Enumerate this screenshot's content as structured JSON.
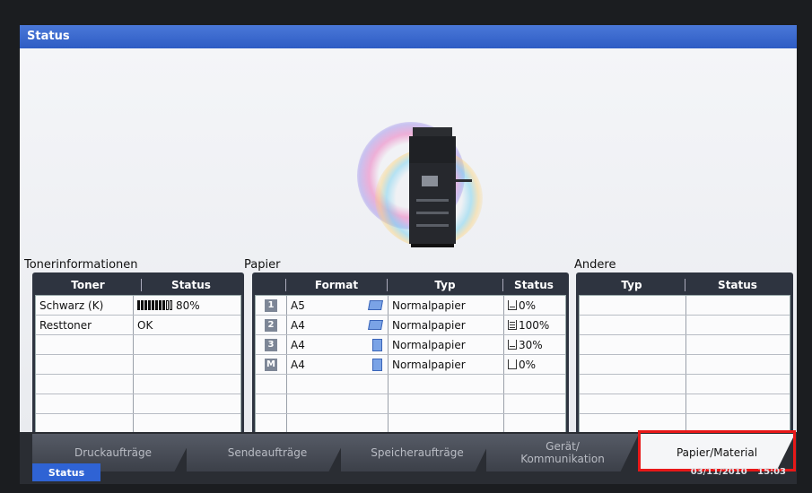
{
  "title": "Status",
  "sections": {
    "toner": "Tonerinformationen",
    "paper": "Papier",
    "other": "Andere"
  },
  "toner_table": {
    "headers": [
      "Toner",
      "Status"
    ],
    "rows": [
      {
        "name": "Schwarz (K)",
        "status": "80%",
        "level_fraction": 0.8
      },
      {
        "name": "Resttoner",
        "status": "OK"
      }
    ]
  },
  "paper_table": {
    "headers": [
      "Format",
      "Typ",
      "Status"
    ],
    "rows": [
      {
        "tray": "1",
        "format": "A5",
        "type": "Normalpapier",
        "status": "0%",
        "icon": "landscape-paper-icon"
      },
      {
        "tray": "2",
        "format": "A4",
        "type": "Normalpapier",
        "status": "100%",
        "icon": "landscape-paper-icon"
      },
      {
        "tray": "3",
        "format": "A4",
        "type": "Normalpapier",
        "status": "30%",
        "icon": "portrait-paper-icon"
      },
      {
        "tray": "M",
        "format": "A4",
        "type": "Normalpapier",
        "status": "0%",
        "icon": "portrait-paper-icon"
      }
    ]
  },
  "other_table": {
    "headers": [
      "Typ",
      "Status"
    ]
  },
  "tabs": [
    {
      "label": "Druckaufträge"
    },
    {
      "label": "Sendeaufträge"
    },
    {
      "label": "Speicheraufträge"
    },
    {
      "label": "Gerät/\nKommunikation"
    },
    {
      "label": "Papier/Material",
      "active": true
    }
  ],
  "status_button": "Status",
  "date": "03/11/2010",
  "time": "15:03",
  "colors": {
    "titlebar": "#2e5cc4",
    "panel": "#2e3440",
    "highlight": "#e81818"
  }
}
